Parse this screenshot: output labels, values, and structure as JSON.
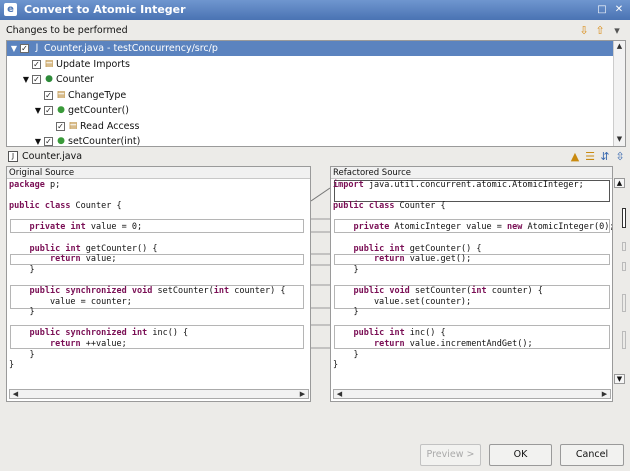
{
  "window": {
    "title": "Convert to Atomic Integer",
    "controls": [
      "□",
      "✕"
    ]
  },
  "changes": {
    "label": "Changes to be performed"
  },
  "tree": [
    {
      "label": "Counter.java - testConcurrency/src/p",
      "icon": "java-file-icon",
      "glyph": "J",
      "twisty": "▼",
      "checked": true,
      "selected": true
    },
    {
      "label": "Update Imports",
      "icon": "change-icon",
      "glyph": "▤",
      "twisty": "",
      "checked": true,
      "selected": false
    },
    {
      "label": "Counter",
      "icon": "class-icon",
      "glyph": "●",
      "twisty": "▼",
      "checked": true,
      "selected": false
    },
    {
      "label": "ChangeType",
      "icon": "change-icon",
      "glyph": "▤",
      "twisty": "",
      "checked": true,
      "selected": false
    },
    {
      "label": "getCounter()",
      "icon": "method-icon",
      "glyph": "●",
      "twisty": "▼",
      "checked": true,
      "selected": false
    },
    {
      "label": "Read Access",
      "icon": "change-icon",
      "glyph": "▤",
      "twisty": "",
      "checked": true,
      "selected": false
    },
    {
      "label": "setCounter(int)",
      "icon": "method-icon",
      "glyph": "●",
      "twisty": "▼",
      "checked": true,
      "selected": false
    }
  ],
  "compare": {
    "file_label": "Counter.java"
  },
  "left_pane": {
    "title": "Original Source",
    "lines": [
      "package p;",
      "",
      "public class Counter {",
      "",
      "    private int value = 0;",
      "",
      "    public int getCounter() {",
      "        return value;",
      "    }",
      "",
      "    public synchronized void setCounter(int counter) {",
      "        value = counter;",
      "    }",
      "",
      "    public synchronized int inc() {",
      "        return ++value;",
      "    }",
      "}"
    ]
  },
  "right_pane": {
    "title": "Refactored Source",
    "lines": [
      "import java.util.concurrent.atomic.AtomicInteger;",
      "",
      "public class Counter {",
      "",
      "    private AtomicInteger value = new AtomicInteger(0);",
      "",
      "    public int getCounter() {",
      "        return value.get();",
      "    }",
      "",
      "    public void setCounter(int counter) {",
      "        value.set(counter);",
      "    }",
      "",
      "    public int inc() {",
      "        return value.incrementAndGet();",
      "    }",
      "}"
    ]
  },
  "buttons": {
    "preview": "Preview >",
    "ok": "OK",
    "cancel": "Cancel"
  },
  "colors": {
    "titlebar": "#4a73b3",
    "selection": "#5b83bf",
    "keyword": "#7a0f55"
  }
}
